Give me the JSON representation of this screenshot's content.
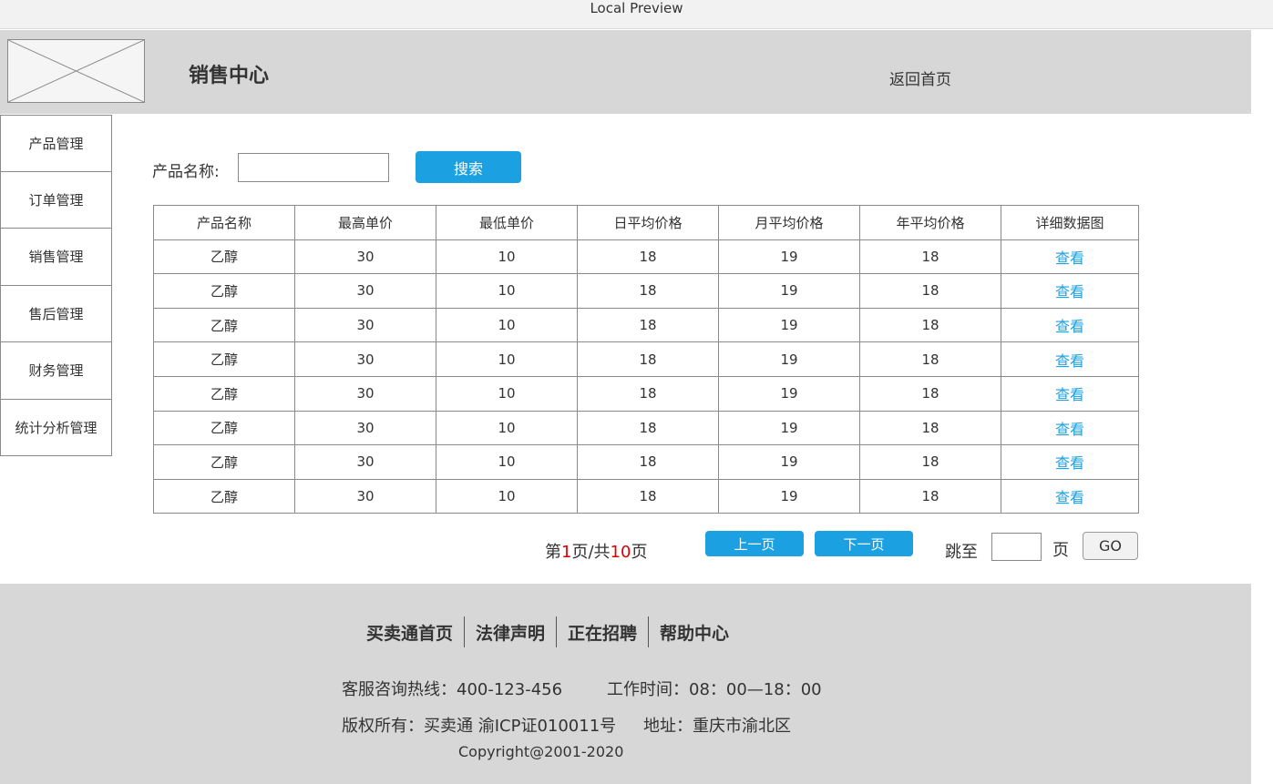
{
  "window": {
    "title": "Local Preview"
  },
  "header": {
    "site_title": "销售中心",
    "home_link": "返回首页"
  },
  "sidebar": {
    "items": [
      {
        "label": "产品管理"
      },
      {
        "label": "订单管理"
      },
      {
        "label": "销售管理"
      },
      {
        "label": "售后管理"
      },
      {
        "label": "财务管理"
      },
      {
        "label": "统计分析管理"
      }
    ]
  },
  "search": {
    "label": "产品名称:",
    "value": "",
    "button": "搜索"
  },
  "table": {
    "columns": [
      "产品名称",
      "最高单价",
      "最低单价",
      "日平均价格",
      "月平均价格",
      "年平均价格",
      "详细数据图"
    ],
    "rows": [
      [
        "乙醇",
        "30",
        "10",
        "18",
        "19",
        "18",
        "查看"
      ],
      [
        "乙醇",
        "30",
        "10",
        "18",
        "19",
        "18",
        "查看"
      ],
      [
        "乙醇",
        "30",
        "10",
        "18",
        "19",
        "18",
        "查看"
      ],
      [
        "乙醇",
        "30",
        "10",
        "18",
        "19",
        "18",
        "查看"
      ],
      [
        "乙醇",
        "30",
        "10",
        "18",
        "19",
        "18",
        "查看"
      ],
      [
        "乙醇",
        "30",
        "10",
        "18",
        "19",
        "18",
        "查看"
      ],
      [
        "乙醇",
        "30",
        "10",
        "18",
        "19",
        "18",
        "查看"
      ],
      [
        "乙醇",
        "30",
        "10",
        "18",
        "19",
        "18",
        "查看"
      ]
    ]
  },
  "pagination": {
    "prefix": "第",
    "current_page": "1",
    "middle": "页/共",
    "total_pages": "10",
    "suffix": "页",
    "prev_label": "上一页",
    "next_label": "下一页",
    "jump_label": "跳至",
    "page_label": "页",
    "go_label": "GO"
  },
  "footer": {
    "links": [
      "买卖通首页",
      "法律声明",
      "正在招聘",
      "帮助中心"
    ],
    "hotline": "客服咨询热线：400-123-456",
    "hours": "工作时间：08：00—18：00",
    "copyright_owner": "版权所有：买卖通 渝ICP证010011号",
    "address": "地址：重庆市渝北区",
    "copyright": "Copyright@2001-2020"
  },
  "colors": {
    "accent": "#1ba1e2",
    "header_bg": "#d7d7d7",
    "page_number": "#e00000"
  }
}
